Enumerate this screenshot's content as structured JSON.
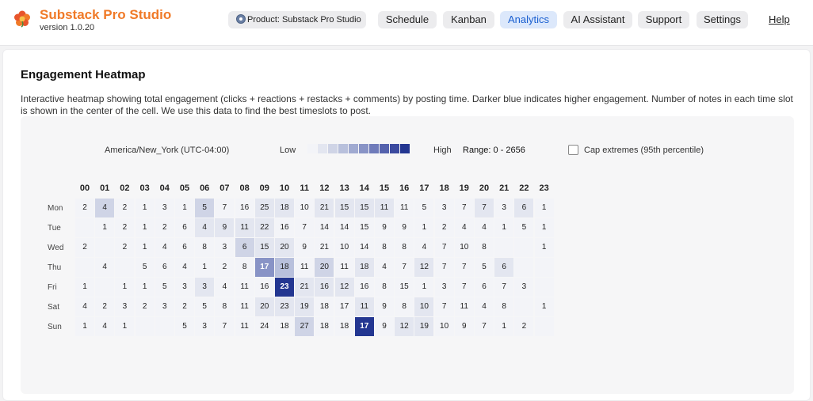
{
  "app": {
    "title": "Substack Pro Studio",
    "version": "version 1.0.20",
    "logo_icon": "flower-logo-icon"
  },
  "nav": {
    "product_label": "Product: Substack Pro Studio",
    "items": [
      {
        "label": "Schedule",
        "active": false
      },
      {
        "label": "Kanban",
        "active": false
      },
      {
        "label": "Analytics",
        "active": true
      },
      {
        "label": "AI Assistant",
        "active": false
      },
      {
        "label": "Support",
        "active": false
      },
      {
        "label": "Settings",
        "active": false
      }
    ],
    "help_label": "Help"
  },
  "section": {
    "title": "Engagement Heatmap",
    "description": "Interactive heatmap showing total engagement (clicks + reactions + restacks + comments) by posting time. Darker blue indicates higher engagement. Number of notes in each time slot is shown in the center of the cell. We use this data to find the best timeslots to post."
  },
  "controls": {
    "timezone": "America/New_York (UTC-04:00)",
    "legend_low": "Low",
    "legend_high": "High",
    "range": "Range: 0 - 2656",
    "cap_label": "Cap extremes (95th percentile)",
    "cap_checked": false
  },
  "colors": {
    "accent": "#1a5fd0",
    "brand": "#f07a28",
    "scale": [
      "#f3f4f8",
      "#e3e6f0",
      "#cfd4e6",
      "#b8c0dc",
      "#a0aad1",
      "#8893c6",
      "#6f7bba",
      "#5462ad",
      "#3b4a9f",
      "#233691"
    ]
  },
  "heatmap": {
    "hours": [
      "00",
      "01",
      "02",
      "03",
      "04",
      "05",
      "06",
      "07",
      "08",
      "09",
      "10",
      "11",
      "12",
      "13",
      "14",
      "15",
      "16",
      "17",
      "18",
      "19",
      "20",
      "21",
      "22",
      "23"
    ],
    "days": [
      "Mon",
      "Tue",
      "Wed",
      "Thu",
      "Fri",
      "Sat",
      "Sun"
    ],
    "counts": [
      [
        "2",
        "4",
        "2",
        "1",
        "3",
        "1",
        "5",
        "7",
        "16",
        "25",
        "18",
        "10",
        "21",
        "15",
        "15",
        "11",
        "11",
        "5",
        "3",
        "7",
        "7",
        "3",
        "6",
        "1"
      ],
      [
        "",
        "1",
        "2",
        "1",
        "2",
        "6",
        "4",
        "9",
        "11",
        "22",
        "16",
        "7",
        "14",
        "14",
        "15",
        "9",
        "9",
        "1",
        "2",
        "4",
        "4",
        "1",
        "5",
        "1"
      ],
      [
        "2",
        "",
        "2",
        "1",
        "4",
        "6",
        "8",
        "3",
        "6",
        "15",
        "20",
        "9",
        "21",
        "10",
        "14",
        "8",
        "8",
        "4",
        "7",
        "10",
        "8",
        "",
        "",
        "1"
      ],
      [
        "",
        "4",
        "",
        "5",
        "6",
        "4",
        "1",
        "2",
        "8",
        "17",
        "18",
        "11",
        "20",
        "11",
        "18",
        "4",
        "7",
        "12",
        "7",
        "7",
        "5",
        "6",
        "",
        ""
      ],
      [
        "1",
        "",
        "1",
        "1",
        "5",
        "3",
        "3",
        "4",
        "11",
        "16",
        "23",
        "21",
        "16",
        "12",
        "16",
        "8",
        "15",
        "1",
        "3",
        "7",
        "6",
        "7",
        "3",
        ""
      ],
      [
        "4",
        "2",
        "3",
        "2",
        "3",
        "2",
        "5",
        "8",
        "11",
        "20",
        "23",
        "19",
        "18",
        "17",
        "11",
        "9",
        "8",
        "10",
        "7",
        "11",
        "4",
        "8",
        "",
        "1"
      ],
      [
        "1",
        "4",
        "1",
        "",
        "",
        "5",
        "3",
        "7",
        "11",
        "24",
        "18",
        "27",
        "18",
        "18",
        "17",
        "9",
        "12",
        "19",
        "10",
        "9",
        "7",
        "1",
        "2",
        ""
      ]
    ],
    "levels": [
      [
        0,
        2,
        0,
        0,
        0,
        0,
        2,
        0,
        0,
        1,
        1,
        0,
        1,
        1,
        1,
        1,
        0,
        0,
        0,
        0,
        1,
        0,
        1,
        0
      ],
      [
        0,
        0,
        0,
        0,
        0,
        0,
        1,
        1,
        1,
        1,
        0,
        0,
        0,
        0,
        0,
        0,
        0,
        0,
        0,
        0,
        0,
        0,
        0,
        0
      ],
      [
        0,
        0,
        0,
        0,
        0,
        0,
        0,
        0,
        2,
        1,
        1,
        0,
        0,
        0,
        0,
        0,
        0,
        0,
        0,
        0,
        0,
        0,
        0,
        0
      ],
      [
        0,
        0,
        0,
        0,
        0,
        0,
        0,
        0,
        0,
        5,
        3,
        0,
        2,
        0,
        1,
        0,
        0,
        1,
        0,
        0,
        0,
        1,
        0,
        0
      ],
      [
        0,
        0,
        0,
        0,
        0,
        0,
        1,
        0,
        0,
        0,
        9,
        1,
        1,
        1,
        0,
        0,
        0,
        0,
        0,
        0,
        0,
        0,
        0,
        0
      ],
      [
        0,
        0,
        0,
        0,
        0,
        0,
        0,
        0,
        0,
        1,
        1,
        1,
        0,
        0,
        1,
        0,
        0,
        1,
        0,
        0,
        0,
        0,
        0,
        0
      ],
      [
        0,
        0,
        0,
        0,
        0,
        0,
        0,
        0,
        0,
        0,
        0,
        2,
        0,
        0,
        9,
        0,
        1,
        1,
        0,
        0,
        0,
        0,
        0,
        0
      ]
    ]
  }
}
